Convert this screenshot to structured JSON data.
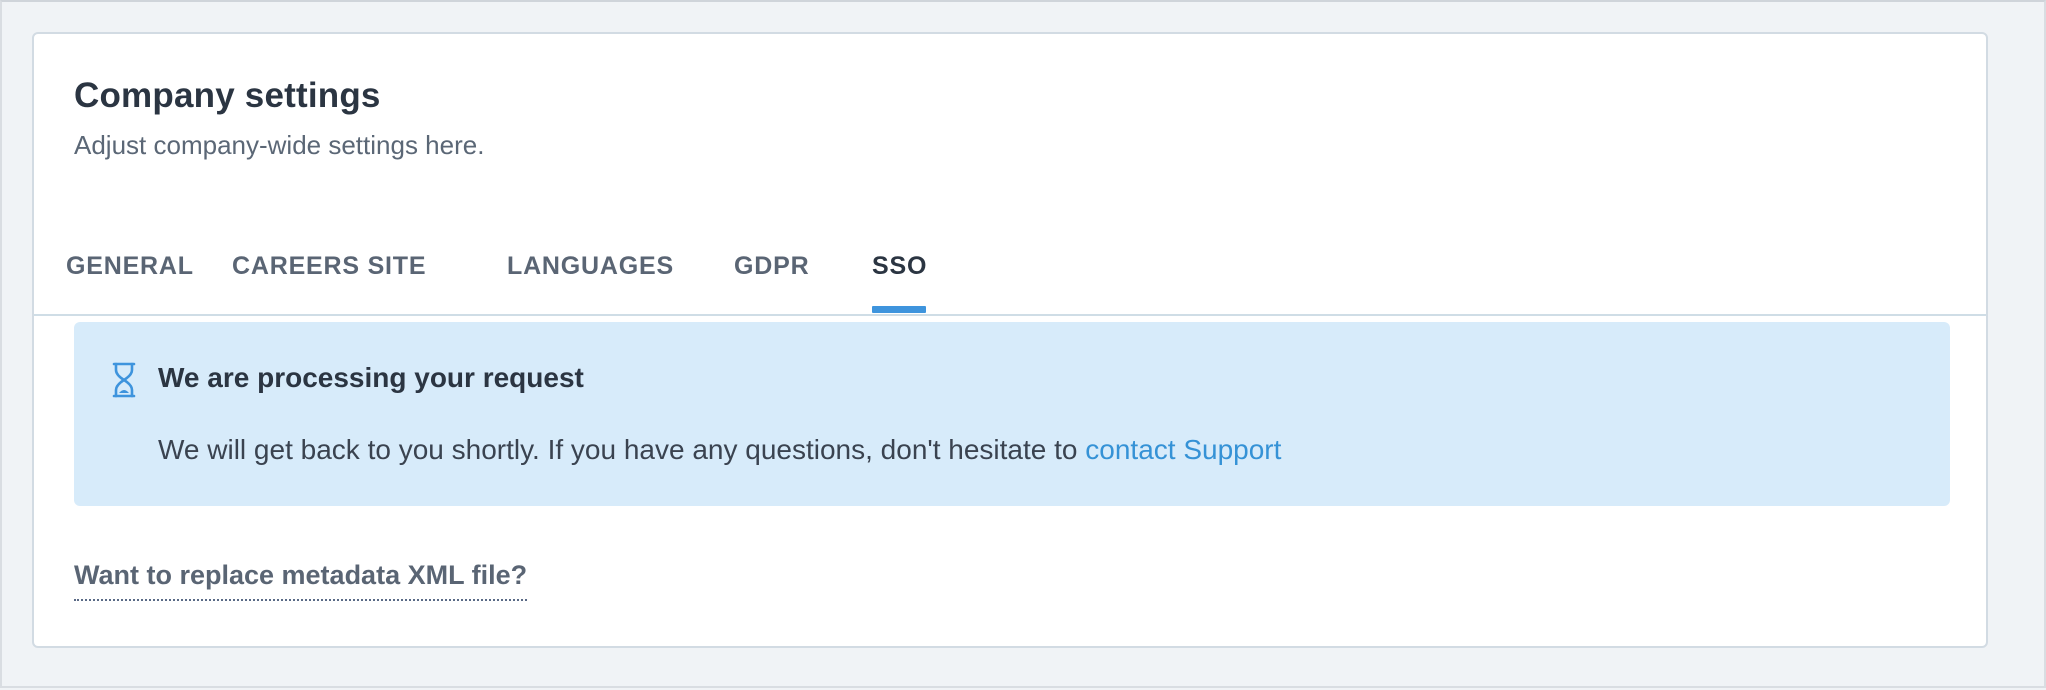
{
  "header": {
    "title": "Company settings",
    "subtitle": "Adjust company-wide settings here."
  },
  "tabs": [
    {
      "label": "GENERAL",
      "active": false
    },
    {
      "label": "CAREERS SITE",
      "active": false
    },
    {
      "label": "LANGUAGES",
      "active": false
    },
    {
      "label": "GDPR",
      "active": false
    },
    {
      "label": "SSO",
      "active": true
    }
  ],
  "notice": {
    "icon": "hourglass-icon",
    "title": "We are processing your request",
    "body": "We will get back to you shortly. If you have any questions, don't hesitate to ",
    "link_label": "contact Support"
  },
  "replace_link": {
    "label": "Want to replace metadata XML file?"
  },
  "colors": {
    "accent": "#3e94dd",
    "link": "#3592d6",
    "notice_bg": "#d7ebfa",
    "page_bg": "#f0f3f6",
    "title_text": "#2b3542",
    "muted_text": "#5a6574"
  }
}
